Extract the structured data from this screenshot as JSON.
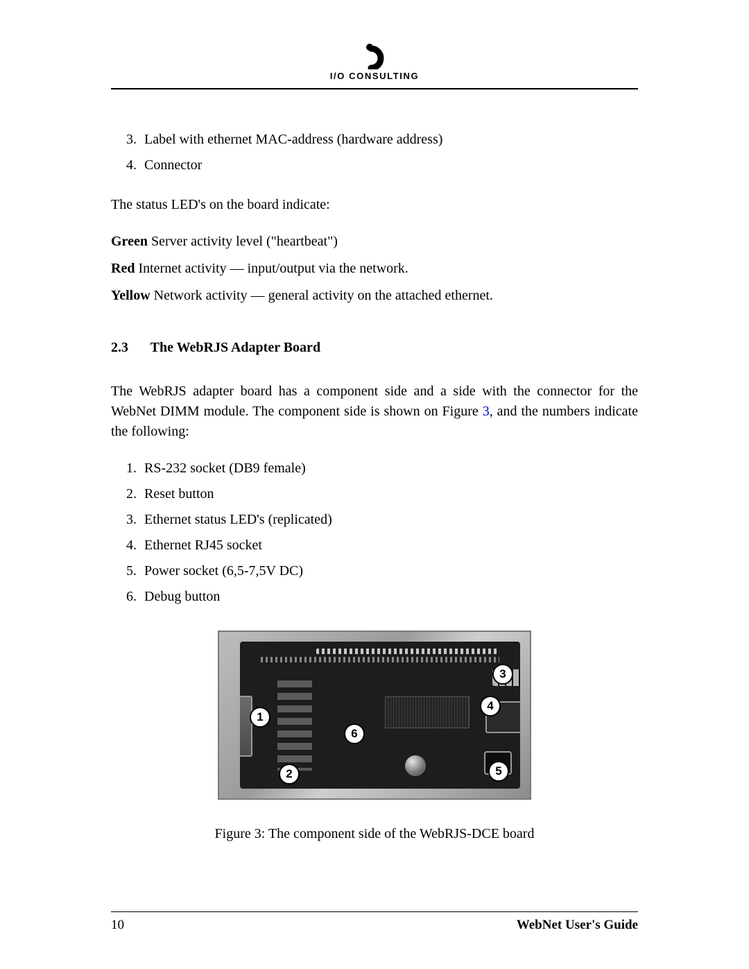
{
  "header": {
    "brand": "I/O CONSULTING"
  },
  "top_list_start": 3,
  "top_list": [
    "Label with ethernet MAC-address (hardware address)",
    "Connector"
  ],
  "status_intro": "The status LED's on the board indicate:",
  "status_items": [
    {
      "term": "Green",
      "desc": "Server activity level (\"heartbeat\")"
    },
    {
      "term": "Red",
      "desc": "Internet activity — input/output via the network."
    },
    {
      "term": "Yellow",
      "desc": "Network activity — general activity on the attached ethernet."
    }
  ],
  "subsection": {
    "number": "2.3",
    "title": "The WebRJS Adapter Board"
  },
  "adapter_intro_pre": "The WebRJS adapter board has a component side and a side with the connector for the WebNet DIMM module. The component side is shown on Figure ",
  "adapter_intro_ref": "3",
  "adapter_intro_post": ", and the numbers indicate the following:",
  "adapter_list": [
    "RS-232 socket (DB9 female)",
    "Reset button",
    "Ethernet status LED's (replicated)",
    "Ethernet RJ45 socket",
    "Power socket (6,5-7,5V DC)",
    "Debug button"
  ],
  "figure": {
    "label": "Figure 3: The component side of the WebRJS-DCE board",
    "callouts": [
      "1",
      "2",
      "3",
      "4",
      "5",
      "6"
    ]
  },
  "footer": {
    "page": "10",
    "doc": "WebNet User's Guide"
  }
}
